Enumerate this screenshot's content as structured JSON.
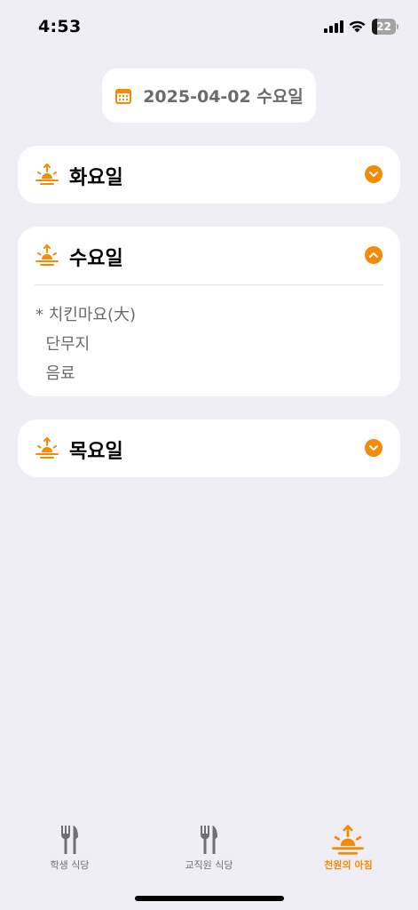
{
  "status_bar": {
    "time": "4:53",
    "battery_level": "22",
    "battery_fraction": 0.22
  },
  "date_selector": {
    "icon": "calendar-icon",
    "text": "2025-04-02 수요일"
  },
  "days": [
    {
      "title": "화요일",
      "icon": "sunrise-icon",
      "expanded": false,
      "menu": []
    },
    {
      "title": "수요일",
      "icon": "sunrise-icon",
      "expanded": true,
      "menu": [
        "* 치킨마요(大)",
        "  단무지",
        "  음료"
      ]
    },
    {
      "title": "목요일",
      "icon": "sunrise-icon",
      "expanded": false,
      "menu": []
    }
  ],
  "tab_bar": {
    "tabs": [
      {
        "label": "학생 식당",
        "icon": "fork-knife-icon",
        "active": false
      },
      {
        "label": "교직원 식당",
        "icon": "fork-knife-icon",
        "active": false
      },
      {
        "label": "천원의 아침",
        "icon": "sunrise-icon",
        "active": true
      }
    ]
  },
  "colors": {
    "accent": "#f58a07",
    "background": "#efeef4",
    "card": "#ffffff",
    "muted_text": "#6b6b6e"
  }
}
